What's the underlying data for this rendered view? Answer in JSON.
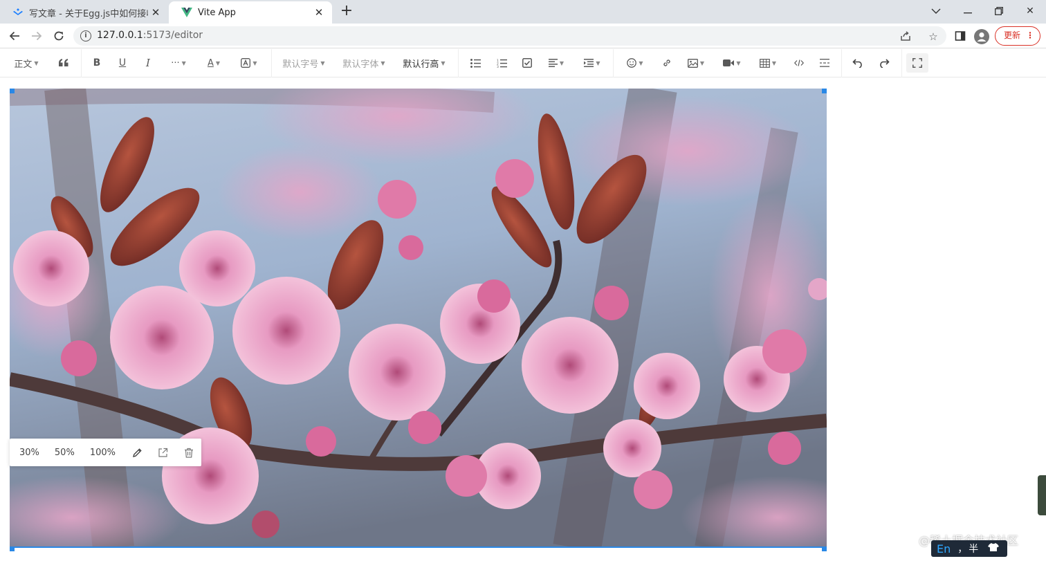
{
  "browser": {
    "tabs": [
      {
        "title": "写文章 - 关于Egg.js中如何接收w",
        "favicon": "juejin-icon",
        "active": false
      },
      {
        "title": "Vite App",
        "favicon": "vue-icon",
        "active": true
      }
    ],
    "new_tab_label": "+",
    "address": {
      "host": "127.0.0.1",
      "path": ":5173/editor"
    },
    "update_label": "更新"
  },
  "toolbar": {
    "paragraph_label": "正文",
    "font_size_label": "默认字号",
    "font_family_label": "默认字体",
    "line_height_label": "默认行高"
  },
  "image_menu": {
    "size_30": "30%",
    "size_50": "50%",
    "size_100": "100%"
  },
  "overlay": {
    "watermark": "@稀土掘金技术社区",
    "ime_lang": "En",
    "ime_rest": "，半"
  },
  "colors": {
    "accent": "#2a88e6",
    "update_red": "#d93025",
    "tab_strip": "#dfe3e8"
  }
}
